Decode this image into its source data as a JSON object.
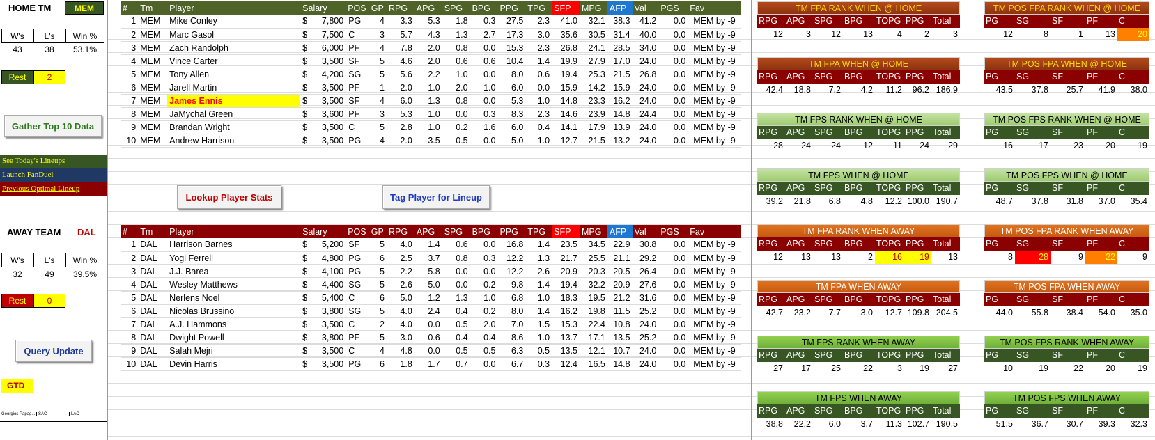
{
  "home": {
    "label": "HOME TM",
    "team": "MEM",
    "record_headers": [
      "W's",
      "L's",
      "Win %"
    ],
    "record_values": [
      "43",
      "38",
      "53.1%"
    ],
    "rest_label": "Rest",
    "rest_value": "2"
  },
  "away": {
    "label": "AWAY TEAM",
    "team": "DAL",
    "record_headers": [
      "W's",
      "L's",
      "Win %"
    ],
    "record_values": [
      "32",
      "49",
      "39.5%"
    ],
    "rest_label": "Rest",
    "rest_value": "0"
  },
  "buttons": {
    "gather": "Gather Top 10 Data",
    "lookup": "Lookup Player Stats",
    "tag": "Tag Player for Lineup",
    "query": "Query Update"
  },
  "links": {
    "lineups": "See Today's Lineups",
    "fanduel": "Launch FanDuel",
    "optimal": "Previous Optimal Lineup"
  },
  "gtd_label": "GTD",
  "mini_row": [
    "Georgios Papag...",
    "SAC",
    "LAC"
  ],
  "player_columns": [
    "#",
    "Tm",
    "Player",
    "Salary",
    "POS",
    "GP",
    "RPG",
    "APG",
    "SPG",
    "BPG",
    "PPG",
    "TPG",
    "SFP",
    "MPG",
    "AFP",
    "Val",
    "PGS",
    "Fav"
  ],
  "home_players": [
    [
      "1",
      "MEM",
      "Mike Conley",
      "$",
      "7,800",
      "PG",
      "4",
      "3.3",
      "5.3",
      "1.8",
      "0.3",
      "27.5",
      "2.3",
      "41.0",
      "32.1",
      "38.3",
      "41.2",
      "0.0",
      "MEM by -9"
    ],
    [
      "2",
      "MEM",
      "Marc Gasol",
      "$",
      "7,500",
      "C",
      "3",
      "5.7",
      "4.3",
      "1.3",
      "2.7",
      "17.3",
      "3.0",
      "35.6",
      "30.5",
      "31.4",
      "40.0",
      "0.0",
      "MEM by -9"
    ],
    [
      "3",
      "MEM",
      "Zach Randolph",
      "$",
      "6,000",
      "PF",
      "4",
      "7.8",
      "2.0",
      "0.8",
      "0.0",
      "15.3",
      "2.3",
      "26.8",
      "24.1",
      "28.5",
      "34.0",
      "0.0",
      "MEM by -9"
    ],
    [
      "4",
      "MEM",
      "Vince Carter",
      "$",
      "3,500",
      "SF",
      "5",
      "4.6",
      "2.0",
      "0.6",
      "0.6",
      "10.4",
      "1.4",
      "19.9",
      "27.9",
      "17.0",
      "24.0",
      "0.0",
      "MEM by -9"
    ],
    [
      "5",
      "MEM",
      "Tony Allen",
      "$",
      "4,200",
      "SG",
      "5",
      "5.6",
      "2.2",
      "1.0",
      "0.0",
      "8.0",
      "0.6",
      "19.4",
      "25.3",
      "21.5",
      "26.8",
      "0.0",
      "MEM by -9"
    ],
    [
      "6",
      "MEM",
      "Jarell Martin",
      "$",
      "3,500",
      "PF",
      "1",
      "2.0",
      "1.0",
      "2.0",
      "1.0",
      "6.0",
      "0.0",
      "15.9",
      "14.2",
      "15.9",
      "24.0",
      "0.0",
      "MEM by -9"
    ],
    [
      "7",
      "MEM",
      "James Ennis",
      "$",
      "3,500",
      "SF",
      "4",
      "6.0",
      "1.3",
      "0.8",
      "0.0",
      "5.3",
      "1.0",
      "14.8",
      "23.3",
      "16.2",
      "24.0",
      "0.0",
      "MEM by -9"
    ],
    [
      "8",
      "MEM",
      "JaMychal Green",
      "$",
      "3,600",
      "PF",
      "3",
      "5.3",
      "1.0",
      "0.0",
      "0.3",
      "8.3",
      "2.3",
      "14.6",
      "23.9",
      "14.8",
      "24.4",
      "0.0",
      "MEM by -9"
    ],
    [
      "9",
      "MEM",
      "Brandan Wright",
      "$",
      "3,500",
      "C",
      "5",
      "2.8",
      "1.0",
      "0.2",
      "1.6",
      "6.0",
      "0.4",
      "14.1",
      "17.9",
      "13.9",
      "24.0",
      "0.0",
      "MEM by -9"
    ],
    [
      "10",
      "MEM",
      "Andrew Harrison",
      "$",
      "3,500",
      "PG",
      "4",
      "2.0",
      "3.5",
      "0.5",
      "0.0",
      "5.0",
      "1.0",
      "12.7",
      "21.5",
      "13.2",
      "24.0",
      "0.0",
      "MEM by -9"
    ]
  ],
  "away_players": [
    [
      "1",
      "DAL",
      "Harrison Barnes",
      "$",
      "5,200",
      "SF",
      "5",
      "4.0",
      "1.4",
      "0.6",
      "0.0",
      "16.8",
      "1.4",
      "23.5",
      "34.5",
      "22.9",
      "30.8",
      "0.0",
      "MEM by -9"
    ],
    [
      "2",
      "DAL",
      "Yogi Ferrell",
      "$",
      "4,800",
      "PG",
      "6",
      "2.5",
      "3.7",
      "0.8",
      "0.3",
      "12.2",
      "1.3",
      "21.7",
      "25.5",
      "21.1",
      "29.2",
      "0.0",
      "MEM by -9"
    ],
    [
      "3",
      "DAL",
      "J.J. Barea",
      "$",
      "4,100",
      "PG",
      "5",
      "2.2",
      "5.8",
      "0.0",
      "0.0",
      "12.2",
      "2.6",
      "20.9",
      "20.3",
      "20.5",
      "26.4",
      "0.0",
      "MEM by -9"
    ],
    [
      "4",
      "DAL",
      "Wesley Matthews",
      "$",
      "4,400",
      "SG",
      "5",
      "2.6",
      "5.0",
      "0.0",
      "0.2",
      "9.8",
      "1.4",
      "19.4",
      "32.2",
      "20.9",
      "27.6",
      "0.0",
      "MEM by -9"
    ],
    [
      "5",
      "DAL",
      "Nerlens Noel",
      "$",
      "5,400",
      "C",
      "6",
      "5.0",
      "1.2",
      "1.3",
      "1.0",
      "6.8",
      "1.0",
      "18.3",
      "19.5",
      "21.2",
      "31.6",
      "0.0",
      "MEM by -9"
    ],
    [
      "6",
      "DAL",
      "Nicolas Brussino",
      "$",
      "3,800",
      "SG",
      "5",
      "4.0",
      "2.4",
      "0.4",
      "0.2",
      "8.0",
      "1.4",
      "16.2",
      "19.8",
      "11.5",
      "25.2",
      "0.0",
      "MEM by -9"
    ],
    [
      "7",
      "DAL",
      "A.J. Hammons",
      "$",
      "3,500",
      "C",
      "2",
      "4.0",
      "0.0",
      "0.5",
      "2.0",
      "7.0",
      "1.5",
      "15.3",
      "22.4",
      "10.8",
      "24.0",
      "0.0",
      "MEM by -9"
    ],
    [
      "8",
      "DAL",
      "Dwight Powell",
      "$",
      "3,800",
      "PF",
      "5",
      "3.0",
      "0.6",
      "0.4",
      "0.4",
      "8.6",
      "1.0",
      "13.7",
      "17.1",
      "13.5",
      "25.2",
      "0.0",
      "MEM by -9"
    ],
    [
      "9",
      "DAL",
      "Salah Mejri",
      "$",
      "3,500",
      "C",
      "4",
      "4.8",
      "0.0",
      "0.5",
      "0.5",
      "6.3",
      "0.5",
      "13.5",
      "12.1",
      "10.7",
      "24.0",
      "0.0",
      "MEM by -9"
    ],
    [
      "10",
      "DAL",
      "Devin Harris",
      "$",
      "3,500",
      "PG",
      "6",
      "1.8",
      "1.7",
      "0.7",
      "0.0",
      "6.7",
      "0.3",
      "12.4",
      "16.5",
      "14.8",
      "24.0",
      "0.0",
      "MEM by -9"
    ]
  ],
  "team_cols": [
    "RPG",
    "APG",
    "SPG",
    "BPG",
    "TOPG",
    "PPG",
    "Total"
  ],
  "pos_cols": [
    "PG",
    "SG",
    "SF",
    "PF",
    "C"
  ],
  "team_blocks": [
    {
      "title": "TM FPA RANK WHEN @ HOME",
      "style": "brown",
      "values": [
        "12",
        "3",
        "12",
        "13",
        "4",
        "2",
        "3"
      ]
    },
    {
      "title": "TM FPA WHEN @ HOME",
      "style": "brown",
      "values": [
        "42.4",
        "18.8",
        "7.2",
        "4.2",
        "11.2",
        "96.2",
        "186.9"
      ]
    },
    {
      "title": "TM FPS RANK WHEN @ HOME",
      "style": "lgreen",
      "values": [
        "28",
        "24",
        "24",
        "12",
        "11",
        "24",
        "29"
      ]
    },
    {
      "title": "TM FPS WHEN @ HOME",
      "style": "lgreen",
      "values": [
        "39.2",
        "21.8",
        "6.8",
        "4.8",
        "12.2",
        "100.0",
        "190.7"
      ]
    },
    {
      "title": "TM FPA RANK WHEN AWAY",
      "style": "orange",
      "values": [
        "12",
        "13",
        "13",
        "2",
        "16",
        "19",
        "13"
      ]
    },
    {
      "title": "TM FPA WHEN AWAY",
      "style": "orange",
      "values": [
        "42.7",
        "23.2",
        "7.7",
        "3.0",
        "12.7",
        "109.8",
        "204.5"
      ]
    },
    {
      "title": "TM FPS RANK WHEN AWAY",
      "style": "green",
      "values": [
        "27",
        "17",
        "25",
        "22",
        "3",
        "19",
        "27"
      ]
    },
    {
      "title": "TM FPS WHEN AWAY",
      "style": "green",
      "values": [
        "38.8",
        "22.2",
        "6.0",
        "3.7",
        "11.3",
        "102.7",
        "190.5"
      ]
    }
  ],
  "pos_blocks": [
    {
      "title": "TM POS FPA RANK WHEN @ HOME",
      "style": "brown",
      "values": [
        "12",
        "8",
        "1",
        "13",
        "20"
      ]
    },
    {
      "title": "TM POS FPA WHEN @ HOME",
      "style": "brown",
      "values": [
        "43.5",
        "37.8",
        "25.7",
        "41.9",
        "38.0"
      ]
    },
    {
      "title": "TM POS FPS RANK WHEN @ HOME",
      "style": "lgreen",
      "values": [
        "16",
        "17",
        "23",
        "20",
        "19"
      ]
    },
    {
      "title": "TM POS FPS WHEN @ HOME",
      "style": "lgreen",
      "values": [
        "48.7",
        "37.8",
        "31.8",
        "37.0",
        "35.4"
      ]
    },
    {
      "title": "TM POS FPA RANK WHEN AWAY",
      "style": "orange",
      "values": [
        "8",
        "28",
        "9",
        "22",
        "9"
      ]
    },
    {
      "title": "TM POS FPA WHEN AWAY",
      "style": "orange",
      "values": [
        "44.0",
        "55.8",
        "38.4",
        "54.0",
        "35.0"
      ]
    },
    {
      "title": "TM POS FPS RANK WHEN AWAY",
      "style": "green",
      "values": [
        "10",
        "19",
        "22",
        "20",
        "19"
      ]
    },
    {
      "title": "TM POS FPS WHEN AWAY",
      "style": "green",
      "values": [
        "51.5",
        "36.7",
        "30.7",
        "39.3",
        "32.3"
      ]
    }
  ],
  "colors": {
    "home_header": "#4f6228",
    "away_header": "#8b0000",
    "highlight_player": "#ffff00",
    "highlight_player_text": "#ff0000"
  }
}
